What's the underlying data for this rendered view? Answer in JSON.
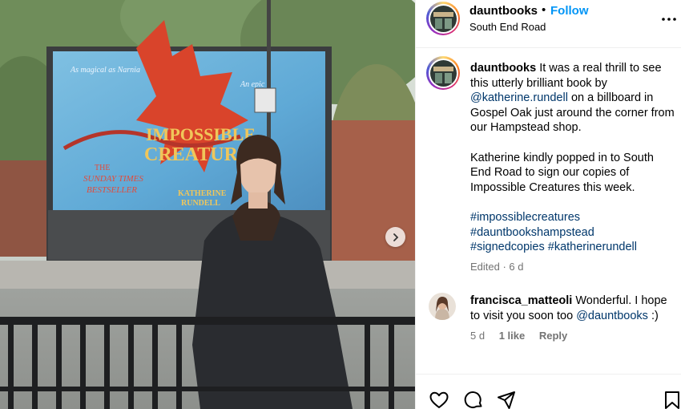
{
  "post": {
    "username": "dauntbooks",
    "location": "South End Road",
    "follow_label": "Follow",
    "separator": "•",
    "caption": {
      "username": "dauntbooks",
      "line1_prefix": "It was a real thrill to see this utterly brilliant book by",
      "mention": "@katherine.rundell",
      "line1_suffix": "on a billboard in Gospel Oak just around the corner from our Hampstead shop.",
      "paragraph2": "Katherine kindly popped in to South End Road to sign our copies of Impossible Creatures this week.",
      "hashtags": [
        "#impossiblecreatures",
        "#dauntbookshampstead",
        "#signedcopies",
        "#katherinerundell"
      ]
    },
    "edited_meta": "Edited · 6 d"
  },
  "comment": {
    "username": "francisca_matteoli",
    "text_prefix": "Wonderful. I hope to visit you soon too",
    "mention": "@dauntbooks",
    "text_suffix": ":)",
    "age": "5 d",
    "likes": "1 like",
    "reply_label": "Reply"
  },
  "billboard": {
    "title_line1": "IMPOSSIBLE",
    "title_line2": "CREATURES",
    "tagline": "As magical as Narnia",
    "tagline2": "An epic",
    "award_line1": "THE",
    "award_line2": "SUNDAY TIMES",
    "award_line3": "BESTSELLER",
    "author_line1": "KATHERINE",
    "author_line2": "RUNDELL"
  },
  "icons": {
    "more": "more-options-icon",
    "like": "heart-icon",
    "comment": "comment-icon",
    "share": "share-icon",
    "save": "bookmark-icon",
    "next": "chevron-right-icon"
  },
  "colors": {
    "link": "#00376b",
    "follow": "#0095f6",
    "meta": "#737373"
  }
}
